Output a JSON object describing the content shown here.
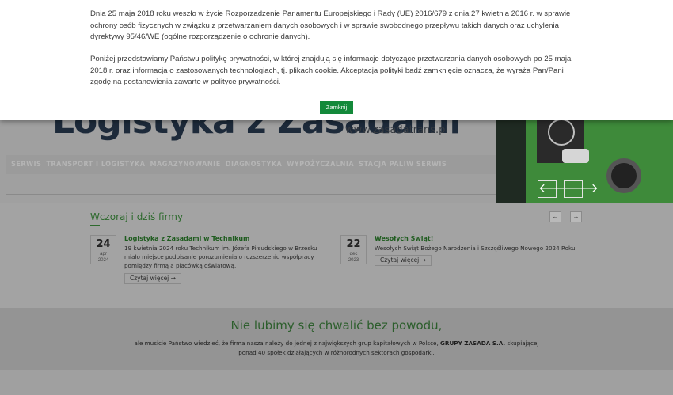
{
  "cookie_banner": {
    "paragraph1": "Dnia 25 maja 2018 roku weszło w życie Rozporządzenie Parlamentu Europejskiego i Rady (UE) 2016/679 z dnia 27 kwietnia 2016 r. w sprawie ochrony osób fizycznych w związku z przetwarzaniem danych osobowych i w sprawie swobodnego przepływu takich danych oraz uchylenia dyrektywy 95/46/WE (ogólne rozporządzenie o ochronie danych).",
    "paragraph2_text": "Poniżej przedstawiamy Państwu politykę prywatności, w której znajdują się informacje dotyczące przetwarzania danych osobowych po 25 maja 2018 r. oraz informacja o zastosowanych technologiach, tj. plikach cookie. Akceptacja polityki bądź zamknięcie oznacza, że wyraża Pan/Pani zgodę na postanowienia zawarte w",
    "policy_link": "polityce prywatności.",
    "close_button": "Zamknij"
  },
  "header": {
    "logo_text": "Logistyka z Zasadami",
    "site_url": "www.zasadatrans.pl",
    "nav_items": [
      "SERWIS",
      "TRANSPORT I LOGISTYKA",
      "MAGAZYNOWANIE",
      "DIAGNOSTYKA",
      "WYPOŻYCZALNIA",
      "STACJA PALIW SERWIS"
    ]
  },
  "slider": {
    "prev_icon": "arrow-left-icon",
    "next_icon": "arrow-right-icon",
    "prev_glyph": "🡐",
    "next_glyph": "🡒"
  },
  "news": {
    "title": "Wczoraj i dziś firmy",
    "prev_glyph": "←",
    "next_glyph": "→",
    "items": [
      {
        "day": "24",
        "month": "apr",
        "year": "2024",
        "heading": "Logistyka z Zasadami w Technikum",
        "body": "19 kwietnia 2024 roku Technikum im. Józefa Piłsudskiego w Brzesku miało miejsce podpisanie porozumienia o rozszerzeniu współpracy pomiędzy firmą a placówką oświatową.",
        "read_more": "Czytaj więcej →"
      },
      {
        "day": "22",
        "month": "dec",
        "year": "2023",
        "heading": "Wesołych Świąt!",
        "body": "Wesołych Świąt Bożego Narodzenia i Szczęśliwego Nowego 2024 Roku",
        "read_more": "Czytaj więcej →"
      }
    ]
  },
  "promo": {
    "title": "Nie lubimy się chwalić bez powodu,",
    "text_before": "ale musicie Państwo wiedzieć, że firma nasza należy do jednej z największych grup kapitałowych w Polsce,",
    "text_bold": "GRUPY ZASADA S.A.",
    "text_after": "skupiającej",
    "text_line2": "ponad 40 spółek działających w różnorodnych sektorach gospodarki."
  },
  "colors": {
    "accent_green": "#13893a",
    "heading_green": "#2e6a2e"
  }
}
